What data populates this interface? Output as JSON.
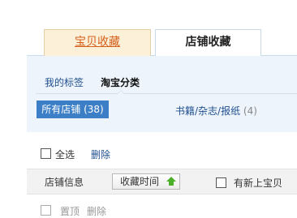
{
  "tabs": [
    {
      "label": "宝贝收藏",
      "active": false
    },
    {
      "label": "店铺收藏",
      "active": true
    }
  ],
  "category_tabs": [
    {
      "label": "我的标签",
      "active": false
    },
    {
      "label": "淘宝分类",
      "active": true
    }
  ],
  "categories": [
    {
      "label": "所有店铺",
      "count": "(38)",
      "selected": true
    },
    {
      "label": "书籍/杂志/报纸",
      "count": "(4)",
      "selected": false
    }
  ],
  "actions": {
    "select_all_label": "全选",
    "delete_label": "删除"
  },
  "table_header": {
    "shop_info": "店铺信息",
    "sort_label": "收藏时间",
    "new_items_label": "有新上宝贝"
  },
  "row": {
    "pin_label": "置顶",
    "delete_label": "删除"
  },
  "colors": {
    "accent_blue": "#3d7fc6",
    "tab_orange": "#d4601a",
    "panel_bg": "#edf4fb",
    "sort_arrow": "#4caf2a"
  }
}
